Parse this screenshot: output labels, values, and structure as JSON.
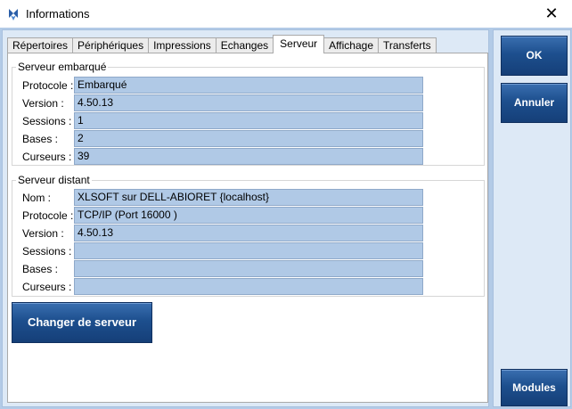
{
  "window": {
    "title": "Informations",
    "close_glyph": "✕"
  },
  "tabs": [
    {
      "label": "Répertoires",
      "active": false
    },
    {
      "label": "Périphériques",
      "active": false
    },
    {
      "label": "Impressions",
      "active": false
    },
    {
      "label": "Echanges",
      "active": false
    },
    {
      "label": "Serveur",
      "active": true
    },
    {
      "label": "Affichage",
      "active": false
    },
    {
      "label": "Transferts",
      "active": false
    }
  ],
  "embedded": {
    "title": "Serveur embarqué",
    "fields": [
      {
        "label": "Protocole :",
        "value": "Embarqué"
      },
      {
        "label": "Version :",
        "value": "4.50.13"
      },
      {
        "label": "Sessions :",
        "value": "1"
      },
      {
        "label": "Bases :",
        "value": "2"
      },
      {
        "label": "Curseurs :",
        "value": "39"
      }
    ]
  },
  "remote": {
    "title": "Serveur distant",
    "fields": [
      {
        "label": "Nom :",
        "value": "XLSOFT sur DELL-ABIORET {localhost}"
      },
      {
        "label": "Protocole :",
        "value": "TCP/IP (Port 16000 )"
      },
      {
        "label": "Version :",
        "value": "4.50.13"
      },
      {
        "label": "Sessions :",
        "value": ""
      },
      {
        "label": "Bases :",
        "value": ""
      },
      {
        "label": "Curseurs :",
        "value": ""
      }
    ]
  },
  "buttons": {
    "change_server": "Changer de serveur",
    "ok": "OK",
    "cancel": "Annuler",
    "modules": "Modules"
  },
  "colors": {
    "field_bg": "#b0c9e6",
    "button_blue": "#1d4f8e",
    "panel_bg": "#dde9f6"
  }
}
